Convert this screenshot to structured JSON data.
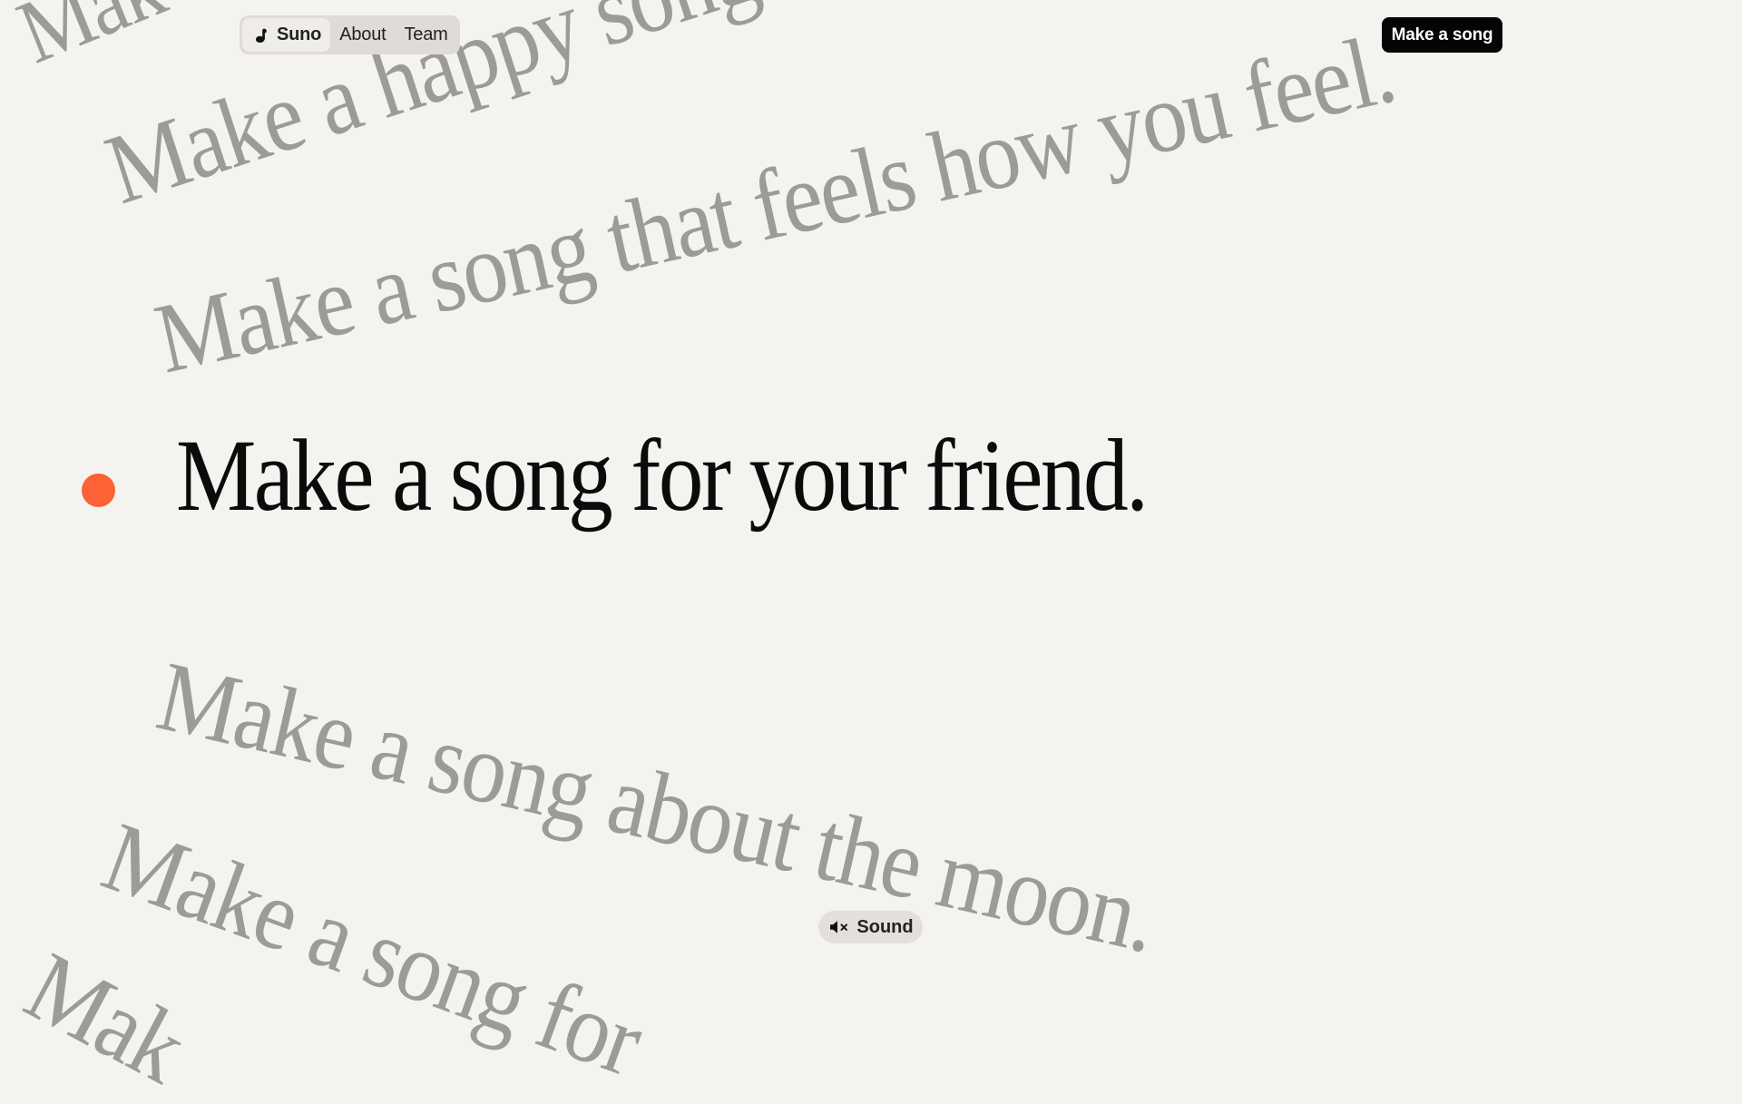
{
  "nav": {
    "items": [
      {
        "label": "Suno",
        "icon": "suno-logo-icon",
        "active": true
      },
      {
        "label": "About"
      },
      {
        "label": "Team"
      }
    ]
  },
  "cta": {
    "label": "Make a song"
  },
  "hero": {
    "text": "Make a song for your friend.",
    "dot_color": "#fb6235"
  },
  "ghost_lines": [
    "Mak",
    "Make a happy song",
    "Make a song that feels how you feel.",
    "Make a song about the moon.",
    "Make a song for",
    "Mak"
  ],
  "sound": {
    "label": "Sound",
    "icon": "speaker-muted-icon"
  },
  "colors": {
    "background": "#f4f3ef",
    "ghost_text": "#9b9b99",
    "primary_text": "#0b0b0b",
    "accent": "#fb6235",
    "cta_background": "#050505"
  }
}
